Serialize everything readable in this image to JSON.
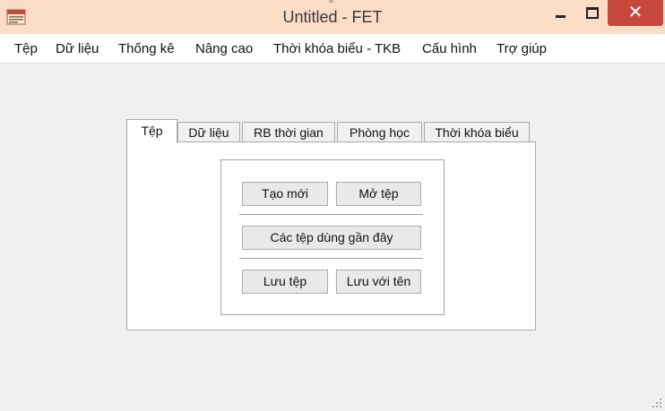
{
  "window": {
    "title": "Untitled - FET",
    "close_symbol": "✕"
  },
  "menu": [
    "Tệp",
    "Dữ liệu",
    "Thống kê",
    "Nâng cao",
    "Thời khóa biểu - TKB",
    "Cấu hình",
    "Trợ giúp"
  ],
  "tabs": [
    {
      "label": "Tệp",
      "active": true
    },
    {
      "label": "Dữ liệu",
      "active": false
    },
    {
      "label": "RB thời gian",
      "active": false
    },
    {
      "label": "Phòng học",
      "active": false
    },
    {
      "label": "Thời khóa biểu",
      "active": false
    }
  ],
  "file_panel": {
    "new_label": "Tạo mới",
    "open_label": "Mở tệp",
    "recent_label": "Các tệp dùng gần đây",
    "save_label": "Lưu tệp",
    "save_as_label": "Lưu với tên"
  },
  "colors": {
    "titlebar_bg": "#fbdcc6",
    "close_button": "#c9483d",
    "client_bg": "#f0f0f0"
  }
}
